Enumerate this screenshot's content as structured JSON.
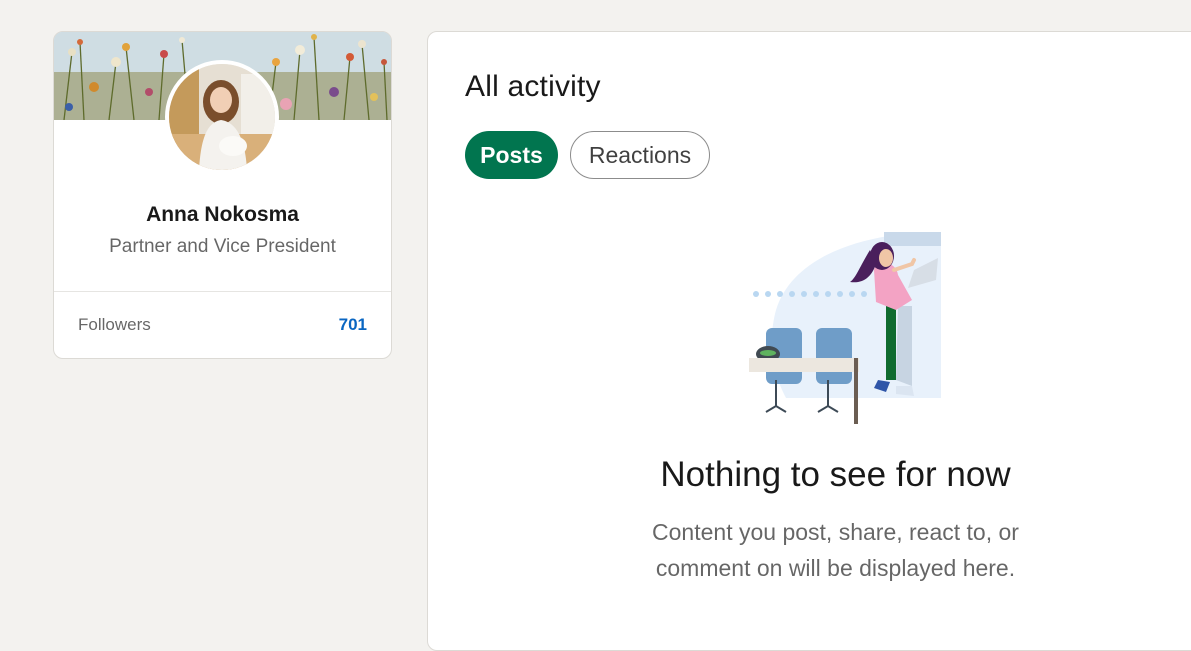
{
  "profile": {
    "name": "Anna Nokosma",
    "headline": "Partner and Vice President",
    "followers_label": "Followers",
    "followers_count": "701"
  },
  "activity": {
    "title": "All activity",
    "tabs": [
      {
        "label": "Posts",
        "selected": true
      },
      {
        "label": "Reactions",
        "selected": false
      }
    ],
    "empty_state": {
      "title": "Nothing to see for now",
      "line1": "Content you post, share, react to, or",
      "line2": "comment on will be displayed here."
    }
  },
  "colors": {
    "accent_green": "#01754f",
    "link_blue": "#0a66c2",
    "page_background": "#f3f2ef"
  },
  "icons": [
    "empty-activity-illustration"
  ]
}
